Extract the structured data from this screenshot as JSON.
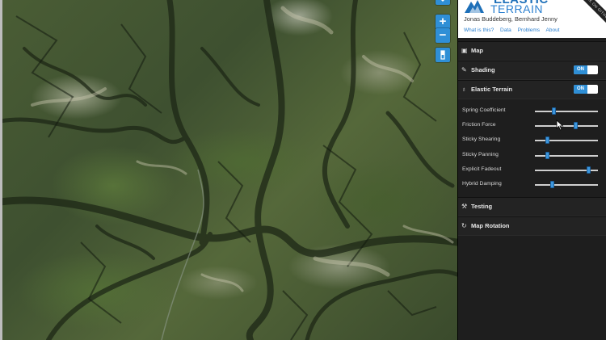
{
  "map": {
    "controls": {
      "zoom_in_label": "+",
      "zoom_out_label": "−"
    }
  },
  "panel": {
    "logo": {
      "line1": "ELASTIC",
      "line2": "TERRAIN",
      "ribbon_text": "FORK ON GITHUB"
    },
    "authors": "Jonas Buddeberg, Bernhard Jenny",
    "links": [
      "What is this?",
      "Data",
      "Problems",
      "About"
    ],
    "sections": {
      "map": {
        "label": "Map",
        "icon": "image-icon"
      },
      "shading": {
        "label": "Shading",
        "icon": "brush-icon",
        "toggle": "ON"
      },
      "elastic": {
        "label": "Elastic Terrain",
        "icon": "bulb-icon",
        "toggle": "ON"
      },
      "testing": {
        "label": "Testing",
        "icon": "wrench-icon"
      },
      "rotation": {
        "label": "Map Rotation",
        "icon": "refresh-icon"
      }
    },
    "sliders": [
      {
        "label": "Spring Coefficient",
        "value": 0.3
      },
      {
        "label": "Friction Force",
        "value": 0.65
      },
      {
        "label": "Sticky Shearing",
        "value": 0.2
      },
      {
        "label": "Sticky Panning",
        "value": 0.2
      },
      {
        "label": "Explicit Fadeout",
        "value": 0.85
      },
      {
        "label": "Hybrid Damping",
        "value": 0.27
      }
    ]
  },
  "colors": {
    "accent": "#2f8fd6",
    "panel_bg": "#1e1e1e"
  }
}
